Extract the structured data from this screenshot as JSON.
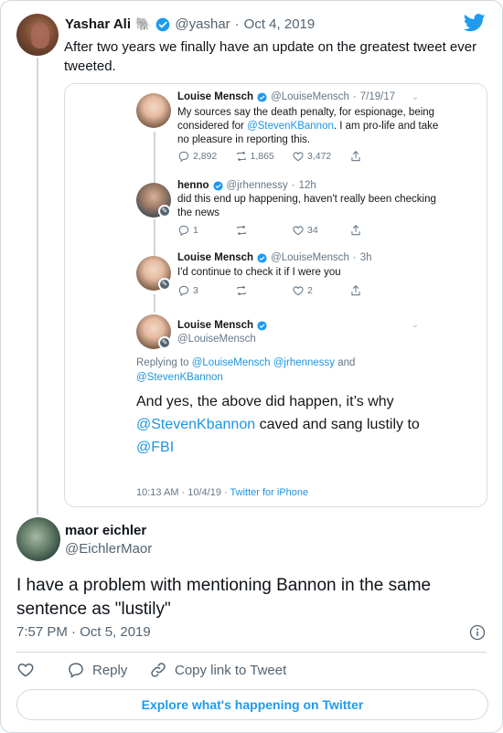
{
  "top_tweet": {
    "name": "Yashar Ali",
    "emoji": "🐘",
    "handle": "@yashar",
    "separator": "·",
    "date": "Oct 4, 2019",
    "text": "After two years we finally have an update on the greatest tweet ever tweeted."
  },
  "embedded": {
    "tweet1": {
      "name": "Louise Mensch",
      "handle": "@LouiseMensch",
      "sep": "·",
      "date": "7/19/17",
      "text_before": "My sources say the death penalty, for espionage, being considered for ",
      "mention": "@StevenKBannon",
      "text_after": ". I am pro-life and take no pleasure in reporting this.",
      "replies": "2,892",
      "retweets": "1,865",
      "likes": "3,472"
    },
    "tweet2": {
      "name": "henno",
      "handle": "@jrhennessy",
      "sep": "·",
      "date": "12h",
      "text": "did this end up happening, haven't really been checking the news",
      "replies": "1",
      "retweets": "",
      "likes": "34"
    },
    "tweet3": {
      "name": "Louise Mensch",
      "handle": "@LouiseMensch",
      "sep": "·",
      "date": "3h",
      "text": "I'd continue to check it if I were you",
      "replies": "3",
      "retweets": "",
      "likes": "2"
    },
    "main": {
      "name": "Louise Mensch",
      "handle": "@LouiseMensch",
      "replying_prefix": "Replying to ",
      "replying_mentions": "@LouiseMensch @jrhennessy",
      "replying_and": " and ",
      "replying_last": "@StevenKBannon",
      "text_part1": "And yes, the above did happen, it’s why ",
      "mention1": "@StevenKbannon",
      "text_part2": " caved and sang lustily to ",
      "mention2": "@FBI",
      "time": "10:13 AM · 10/4/19 · ",
      "source": "Twitter for iPhone"
    }
  },
  "reply_tweet": {
    "name": "maor eichler",
    "handle": "@EichlerMaor",
    "text": "I have a problem with mentioning Bannon in the same sentence as \"lustily\"",
    "time": "7:57 PM · Oct 5, 2019"
  },
  "actions": {
    "reply_label": "Reply",
    "copy_label": "Copy link to Tweet"
  },
  "explore_label": "Explore what's happening on Twitter",
  "colors": {
    "twitter_blue": "#1d9bf0",
    "link_blue": "#1b95e0",
    "muted": "#536471"
  }
}
